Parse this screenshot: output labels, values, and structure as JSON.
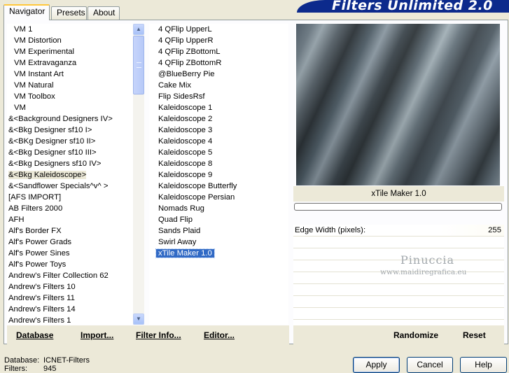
{
  "tabs": [
    "Navigator",
    "Presets",
    "About"
  ],
  "banner": "Filters Unlimited 2.0",
  "categories": [
    "VM 1",
    "VM Distortion",
    "VM Experimental",
    "VM Extravaganza",
    "VM Instant Art",
    "VM Natural",
    "VM Toolbox",
    "VM",
    "&<Background Designers IV>",
    "&<Bkg Designer sf10 I>",
    "&<BKg Designer sf10 II>",
    "&<Bkg Designer sf10 III>",
    "&<Bkg Designers sf10 IV>",
    "&<Bkg Kaleidoscope>",
    "&<Sandflower Specials^v^ >",
    "[AFS IMPORT]",
    "AB Filters 2000",
    "AFH",
    "Alf's Border FX",
    "Alf's Power Grads",
    "Alf's Power Sines",
    "Alf's Power Toys",
    "Andrew's Filter Collection 62",
    "Andrew's Filters 10",
    "Andrew's Filters 11",
    "Andrew's Filters 14",
    "Andrew's Filters 1"
  ],
  "filters": [
    "4 QFlip UpperL",
    "4 QFlip UpperR",
    "4 QFlip ZBottomL",
    "4 QFlip ZBottomR",
    "@BlueBerry Pie",
    "Cake Mix",
    "Flip SidesRsf",
    "Kaleidoscope 1",
    "Kaleidoscope 2",
    "Kaleidoscope 3",
    "Kaleidoscope 4",
    "Kaleidoscope 5",
    "Kaleidoscope 8",
    "Kaleidoscope 9",
    "Kaleidoscope Butterfly",
    "Kaleidoscope Persian",
    "Nomads Rug",
    "Quad Flip",
    "Sands Plaid",
    "Swirl Away",
    "xTile Maker 1.0"
  ],
  "selected_filter": "xTile Maker 1.0",
  "filter_title": "xTile Maker 1.0",
  "param": {
    "label": "Edge Width (pixels):",
    "value": "255"
  },
  "watermark": {
    "line1": "Pinuccia",
    "line2": "www.maidiregrafica.eu"
  },
  "bottom_left": {
    "database_label": "Database",
    "import_label": "Import...",
    "filter_info_label": "Filter Info...",
    "editor_label": "Editor..."
  },
  "bottom_right": {
    "randomize_label": "Randomize",
    "reset_label": "Reset"
  },
  "status": {
    "database_key": "Database:",
    "database_value": "ICNET-Filters",
    "filters_key": "Filters:",
    "filters_value": "945"
  },
  "dialog": {
    "apply_label": "Apply",
    "cancel_label": "Cancel",
    "help_label": "Help"
  }
}
